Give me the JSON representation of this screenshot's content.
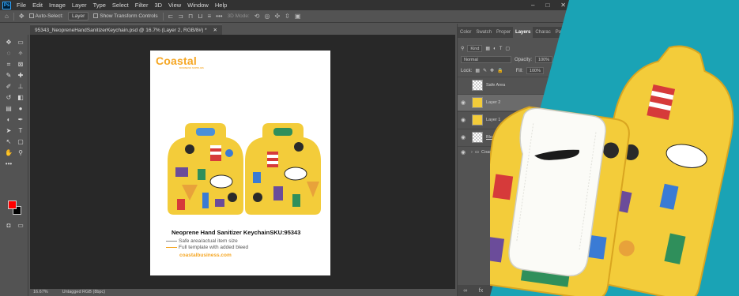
{
  "menubar": {
    "logo": "Ps",
    "items": [
      "File",
      "Edit",
      "Image",
      "Layer",
      "Type",
      "Select",
      "Filter",
      "3D",
      "View",
      "Window",
      "Help"
    ],
    "controls": [
      "–",
      "□",
      "✕"
    ]
  },
  "options": {
    "auto_select_label": "Auto-Select:",
    "auto_select_value": "Layer",
    "transform_label": "Show Transform Controls",
    "mode_label": "3D Mode:"
  },
  "document": {
    "tab_title": "95343_NeopreneHandSanitizerKeychain.psd @ 16.7% (Layer 2, RGB/8#) *",
    "zoom": "16.67%",
    "color_profile": "Untagged RGB (8bpc)"
  },
  "artboard": {
    "logo_text": "Coastal",
    "logo_sub": "BUSINESS SUPPLIES",
    "product_title": "Neoprene Hand Sanitizer KeychainSKU:95343",
    "legend_safe": "Safe area/actual item size",
    "legend_full": "Full template with added bleed",
    "website": "coastalbusiness.com",
    "safe_color": "#8a8a8a",
    "bleed_color": "#f5a623",
    "pattern_color": "#f3cc3a"
  },
  "panel": {
    "tabs": [
      "Color",
      "Swatch",
      "Proper",
      "Layers",
      "Charac",
      "Parage"
    ],
    "active_tab": "Layers",
    "kind_label": "Kind",
    "blend_mode": "Normal",
    "opacity_label": "Opacity:",
    "opacity_value": "100%",
    "lock_label": "Lock:",
    "fill_label": "Fill:",
    "fill_value": "100%",
    "layers": [
      {
        "name": "Safe Area",
        "visible": false,
        "thumb": "checker"
      },
      {
        "name": "Layer 2",
        "visible": true,
        "thumb": "yellow",
        "selected": true
      },
      {
        "name": "Layer 1",
        "visible": true,
        "thumb": "yellow"
      },
      {
        "name": "Bleed",
        "visible": true,
        "thumb": "checker"
      },
      {
        "name": "Coastal Bra",
        "visible": true,
        "thumb": "group"
      }
    ]
  },
  "photo": {
    "background_color": "#1aa3b5",
    "pattern_color": "#f3cc3a",
    "tab_color": "#fbfbf7"
  }
}
